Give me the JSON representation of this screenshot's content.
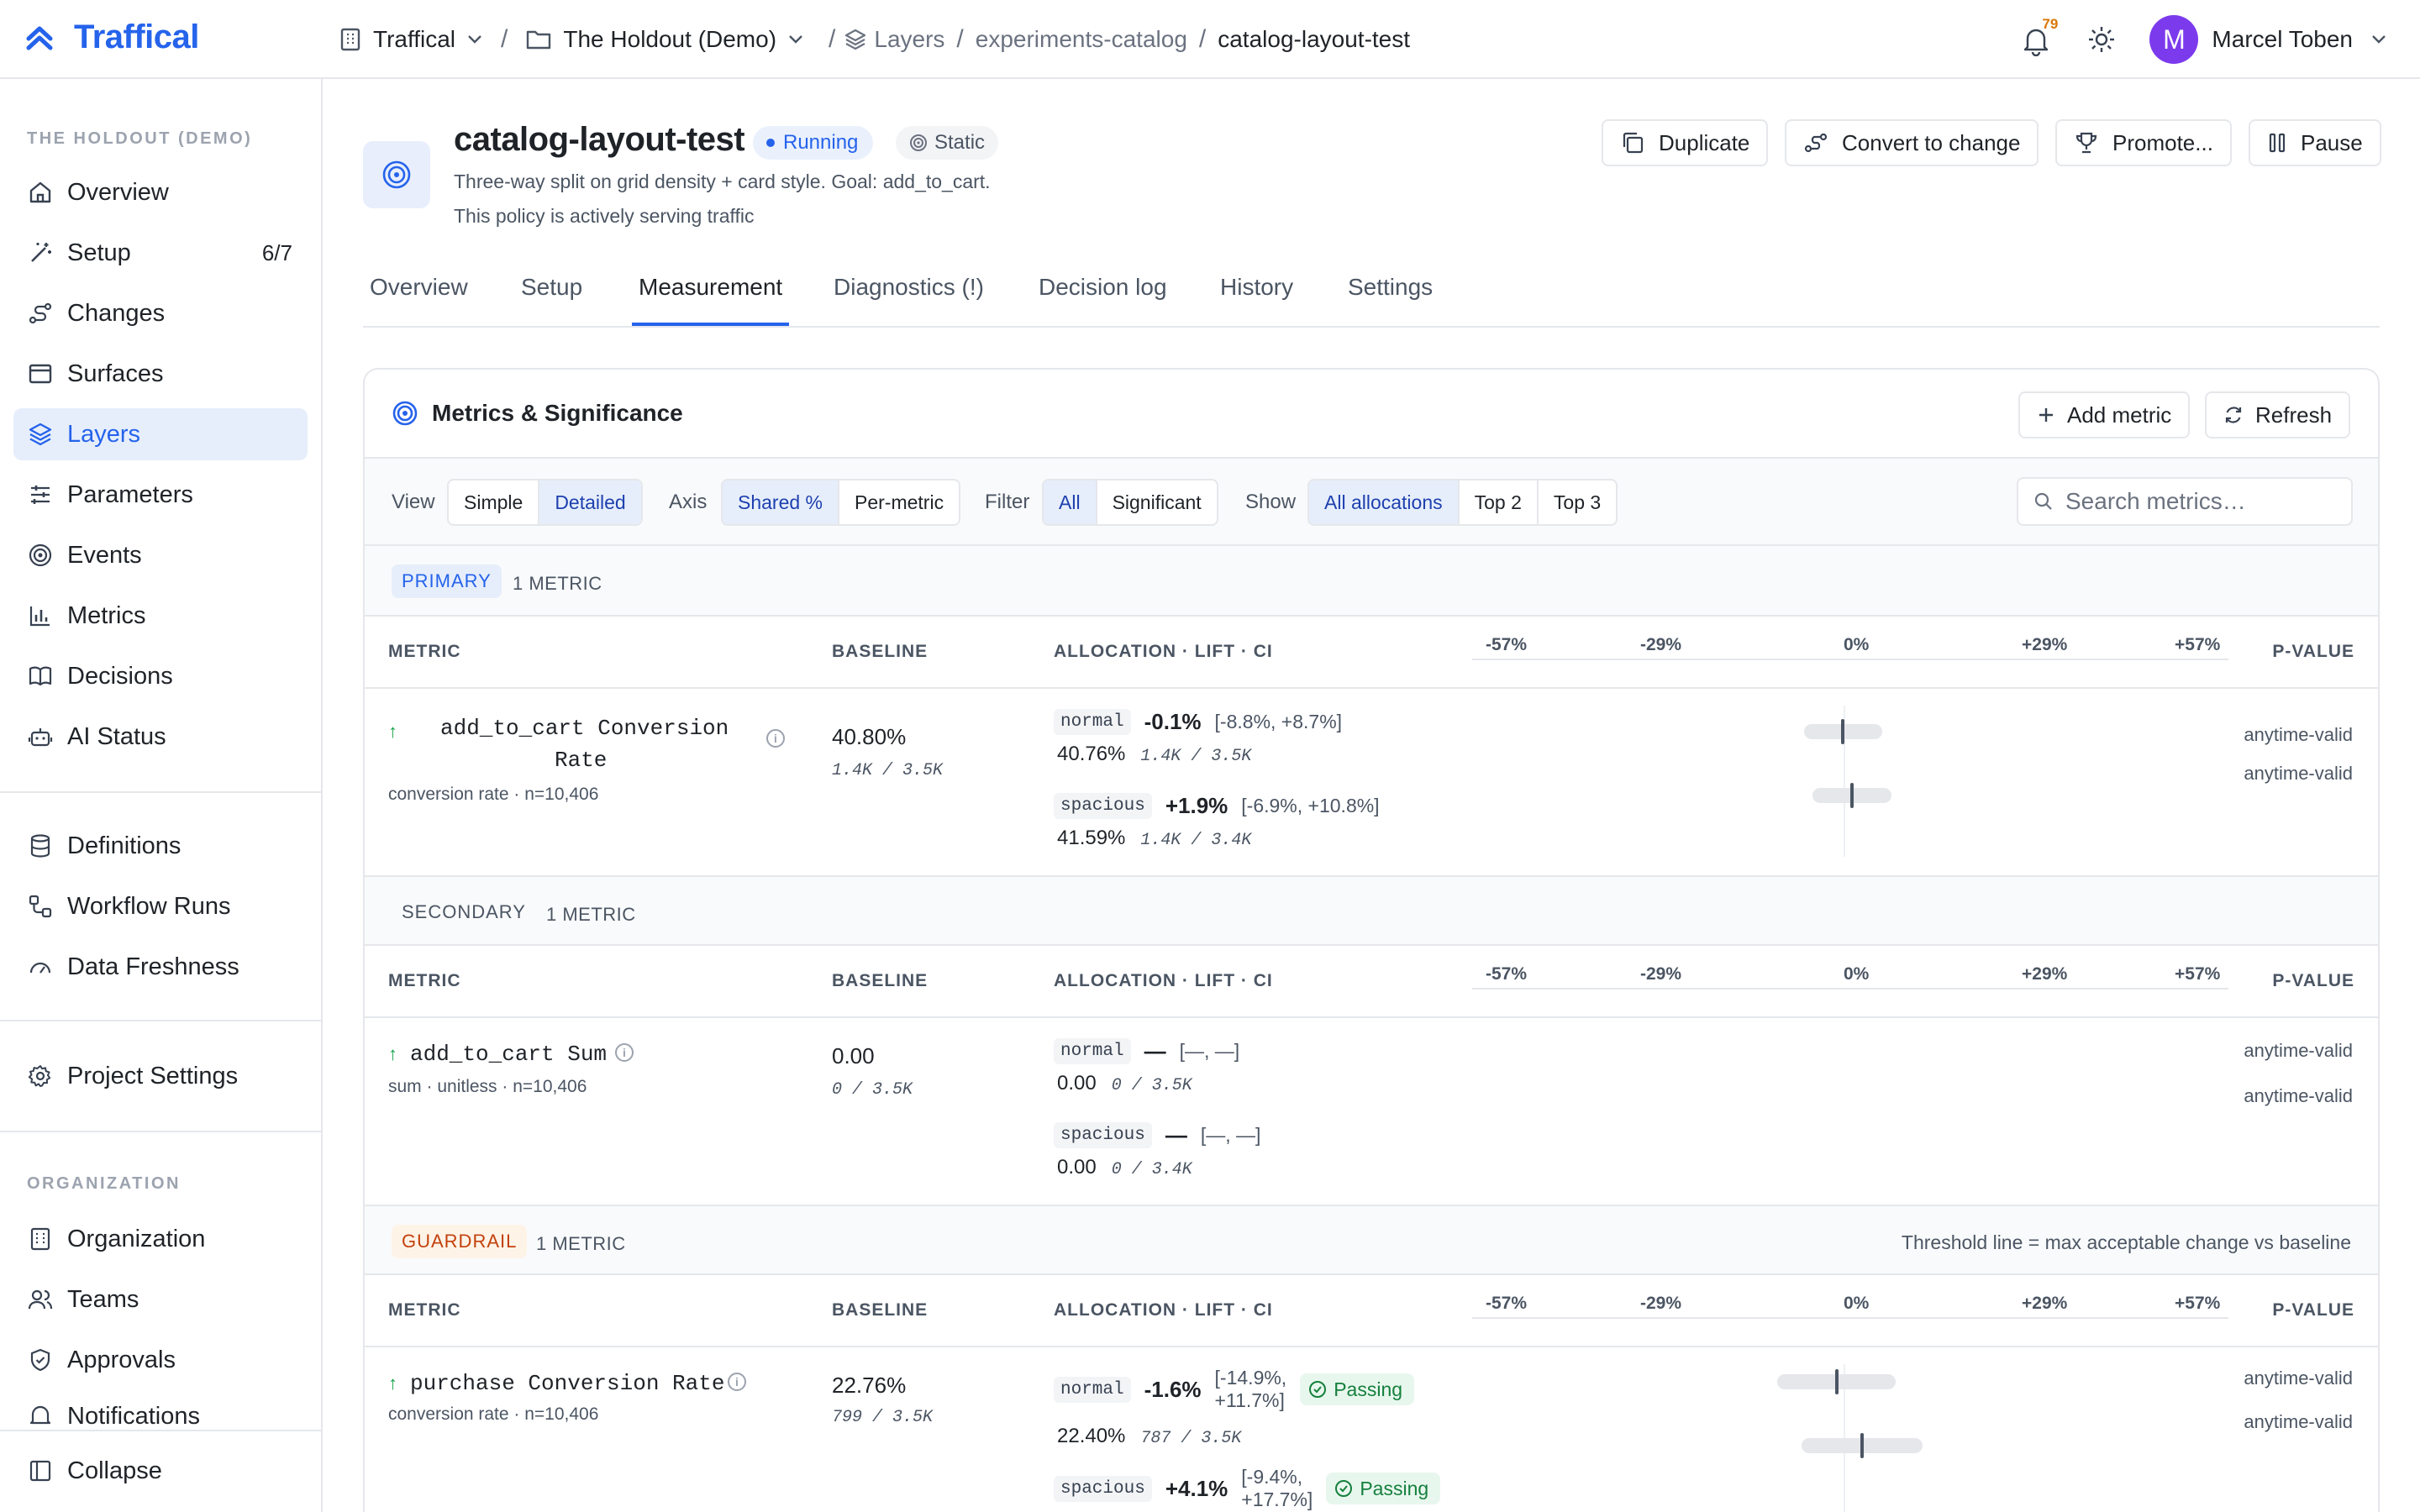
{
  "app": {
    "brand": "Traffical"
  },
  "breadcrumb": {
    "org": "Traffical",
    "project": "The Holdout (Demo)",
    "layers": "Layers",
    "catalog": "experiments-catalog",
    "current": "catalog-layout-test"
  },
  "topbar": {
    "notifications_count": "79",
    "user_initial": "M",
    "user_name": "Marcel Toben"
  },
  "sidebar": {
    "section_project": "THE HOLDOUT (DEMO)",
    "items": [
      {
        "label": "Overview",
        "icon": "home-icon"
      },
      {
        "label": "Setup",
        "icon": "wand-icon",
        "count": "6/7"
      },
      {
        "label": "Changes",
        "icon": "route-icon"
      },
      {
        "label": "Surfaces",
        "icon": "browser-window-icon"
      },
      {
        "label": "Layers",
        "icon": "layers-icon",
        "active": true
      },
      {
        "label": "Parameters",
        "icon": "sliders-icon"
      },
      {
        "label": "Events",
        "icon": "target-icon"
      },
      {
        "label": "Metrics",
        "icon": "bar-chart-icon"
      },
      {
        "label": "Decisions",
        "icon": "book-icon"
      },
      {
        "label": "AI Status",
        "icon": "bot-icon"
      }
    ],
    "items_tools": [
      {
        "label": "Definitions",
        "icon": "database-icon"
      },
      {
        "label": "Workflow Runs",
        "icon": "workflow-icon"
      },
      {
        "label": "Data Freshness",
        "icon": "gauge-icon"
      }
    ],
    "project_settings": "Project Settings",
    "section_org": "ORGANIZATION",
    "items_org": [
      {
        "label": "Organization",
        "icon": "building-icon"
      },
      {
        "label": "Teams",
        "icon": "users-icon"
      },
      {
        "label": "Approvals",
        "icon": "shield-check-icon"
      },
      {
        "label": "Notifications",
        "icon": "bell-icon"
      }
    ],
    "collapse": "Collapse"
  },
  "experiment": {
    "title": "catalog-layout-test",
    "status": "Running",
    "mode": "Static",
    "description": "Three-way split on grid density + card style. Goal: add_to_cart.",
    "status_text": "This policy is actively serving traffic",
    "actions": {
      "duplicate": "Duplicate",
      "convert": "Convert to change",
      "promote": "Promote...",
      "pause": "Pause"
    }
  },
  "tabs": [
    "Overview",
    "Setup",
    "Measurement",
    "Diagnostics (!)",
    "Decision log",
    "History",
    "Settings"
  ],
  "active_tab": "Measurement",
  "card": {
    "title": "Metrics & Significance",
    "add_metric": "Add metric",
    "refresh": "Refresh",
    "filters": {
      "view_label": "View",
      "view_options": [
        "Simple",
        "Detailed"
      ],
      "view_selected": "Detailed",
      "axis_label": "Axis",
      "axis_options": [
        "Shared %",
        "Per-metric"
      ],
      "axis_selected": "Shared %",
      "filter_label": "Filter",
      "filter_options": [
        "All",
        "Significant"
      ],
      "filter_selected": "All",
      "show_label": "Show",
      "show_options": [
        "All allocations",
        "Top 2",
        "Top 3"
      ],
      "show_selected": "All allocations"
    },
    "search_placeholder": "Search metrics…"
  },
  "columns": {
    "metric": "METRIC",
    "baseline": "BASELINE",
    "allocation": "ALLOCATION · LIFT · CI",
    "pvalue": "P-VALUE"
  },
  "axis_ticks": [
    "-57%",
    "-29%",
    "0%",
    "+29%",
    "+57%"
  ],
  "axis_range": [
    -57,
    57
  ],
  "sections": [
    {
      "tag": "PRIMARY",
      "count": "1 METRIC",
      "metric": {
        "name_line1": "add_to_cart Conversion",
        "name_line2": "Rate",
        "subtitle": "conversion rate · n=10,406",
        "baseline": "40.80%",
        "baseline_n": "1.4K / 3.5K"
      },
      "allocations": [
        {
          "name": "normal",
          "lift": "-0.1%",
          "ci": "[-8.8%, +8.7%]",
          "value": "40.76%",
          "n": "1.4K / 3.5K",
          "pvalue": "anytime-valid",
          "ci_low": -8.8,
          "ci_high": 8.7,
          "point": -0.1
        },
        {
          "name": "spacious",
          "lift": "+1.9%",
          "ci": "[-6.9%, +10.8%]",
          "value": "41.59%",
          "n": "1.4K / 3.4K",
          "pvalue": "anytime-valid",
          "ci_low": -6.9,
          "ci_high": 10.8,
          "point": 1.9
        }
      ]
    },
    {
      "tag": "SECONDARY",
      "count": "1 METRIC",
      "metric": {
        "name_line1": "add_to_cart Sum",
        "subtitle": "sum · unitless · n=10,406",
        "baseline": "0.00",
        "baseline_n": "0 / 3.5K"
      },
      "allocations": [
        {
          "name": "normal",
          "lift": "—",
          "ci": "[—, —]",
          "value": "0.00",
          "n": "0 / 3.5K",
          "pvalue": "anytime-valid"
        },
        {
          "name": "spacious",
          "lift": "—",
          "ci": "[—, —]",
          "value": "0.00",
          "n": "0 / 3.4K",
          "pvalue": "anytime-valid"
        }
      ]
    },
    {
      "tag": "GUARDRAIL",
      "count": "1 METRIC",
      "note": "Threshold line = max acceptable change vs baseline",
      "metric": {
        "name_line1": "purchase Conversion Rate",
        "subtitle": "conversion rate · n=10,406",
        "baseline": "22.76%",
        "baseline_n": "799 / 3.5K"
      },
      "allocations": [
        {
          "name": "normal",
          "lift": "-1.6%",
          "ci_line1": "[-14.9%,",
          "ci_line2": "+11.7%]",
          "badge": "Passing",
          "value": "22.40%",
          "n": "787 / 3.5K",
          "pvalue": "anytime-valid",
          "ci_low": -14.9,
          "ci_high": 11.7,
          "point": -1.6
        },
        {
          "name": "spacious",
          "lift": "+4.1%",
          "ci_line1": "[-9.4%,",
          "ci_line2": "+17.7%]",
          "badge": "Passing",
          "pvalue": "anytime-valid",
          "ci_low": -9.4,
          "ci_high": 17.7,
          "point": 4.1
        }
      ]
    }
  ]
}
